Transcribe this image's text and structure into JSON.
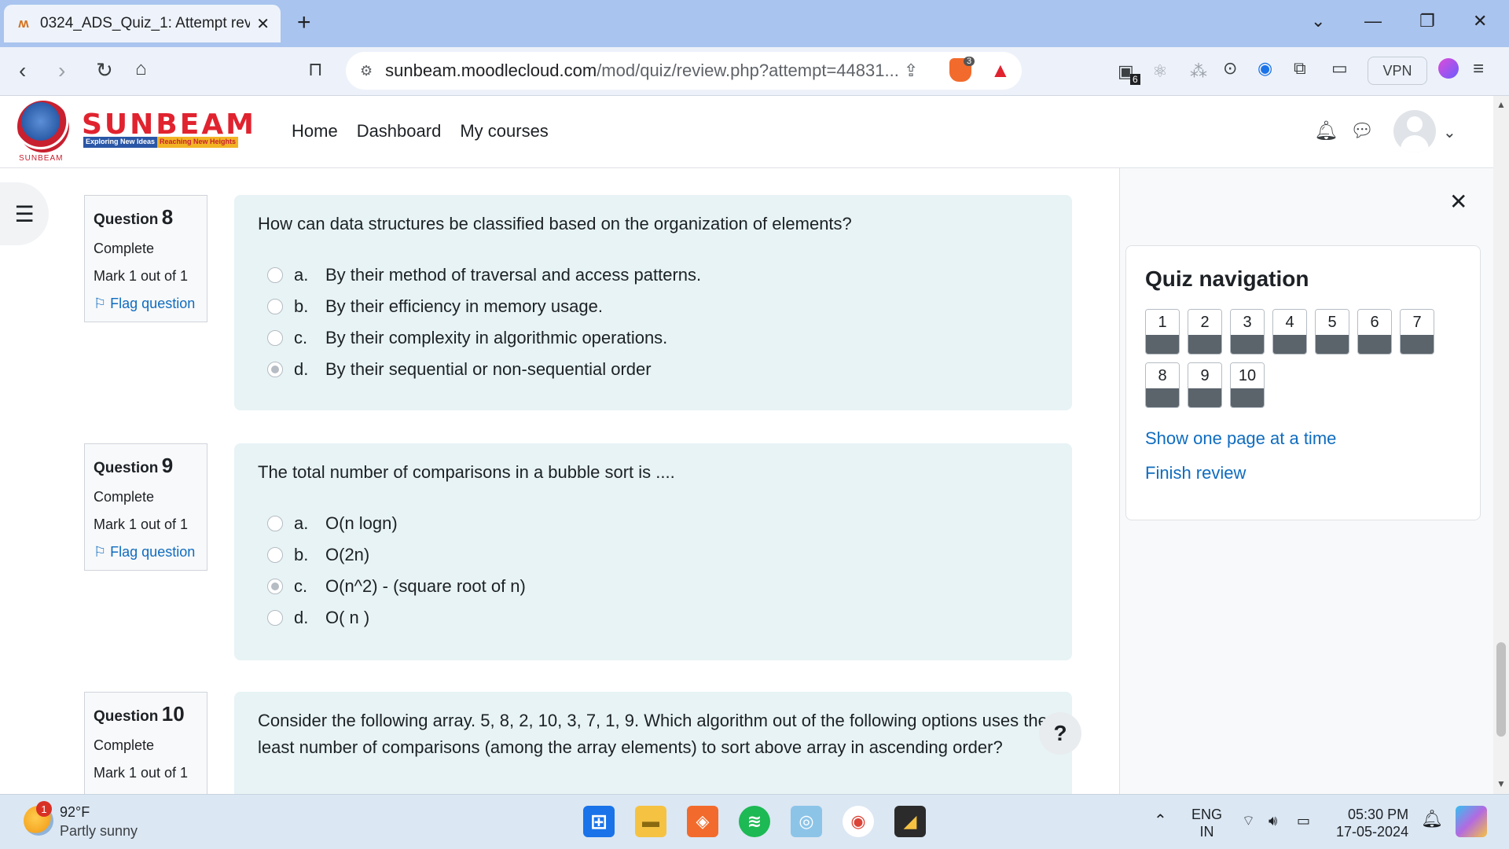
{
  "browser": {
    "tab_title": "0324_ADS_Quiz_1: Attempt revie",
    "tab_favicon": "ʍ",
    "url_host": "sunbeam.moodlecloud.com",
    "url_path": "/mod/quiz/review.php?attempt=44831...",
    "brave_badge": "3",
    "wallet_badge": "6",
    "vpn_label": "VPN"
  },
  "header": {
    "logo_text": "SUNBEAM",
    "logo_tag_1": "Exploring New Ideas",
    "logo_tag_2": "Reaching New Heights",
    "logo_small": "SUNBEAM",
    "nav": [
      "Home",
      "Dashboard",
      "My courses"
    ]
  },
  "questions": [
    {
      "label": "Question",
      "number": "8",
      "status": "Complete",
      "mark": "Mark 1 out of 1",
      "flag": "Flag question",
      "text": "How can data structures be classified based on the organization of elements?",
      "options": [
        {
          "letter": "a.",
          "text": "By their method of traversal and access patterns.",
          "selected": false
        },
        {
          "letter": "b.",
          "text": "By their efficiency in memory usage.",
          "selected": false
        },
        {
          "letter": "c.",
          "text": "By their complexity in algorithmic operations.",
          "selected": false
        },
        {
          "letter": "d.",
          "text": "By their sequential or non-sequential order",
          "selected": true
        }
      ]
    },
    {
      "label": "Question",
      "number": "9",
      "status": "Complete",
      "mark": "Mark 1 out of 1",
      "flag": "Flag question",
      "text": "The total number of comparisons in a bubble sort is ....",
      "options": [
        {
          "letter": "a.",
          "text": "O(n logn)",
          "selected": false
        },
        {
          "letter": "b.",
          "text": "O(2n)",
          "selected": false
        },
        {
          "letter": "c.",
          "text": "O(n^2) - (square root of n)",
          "selected": true
        },
        {
          "letter": "d.",
          "text": "O( n )",
          "selected": false
        }
      ]
    },
    {
      "label": "Question",
      "number": "10",
      "status": "Complete",
      "mark": "Mark 1 out of 1",
      "text": "Consider the following array. 5, 8, 2, 10, 3, 7, 1, 9. Which algorithm out of the following options uses the least number of comparisons (among the array elements) to sort above array in ascending order?"
    }
  ],
  "quiz_nav": {
    "title": "Quiz navigation",
    "buttons": [
      "1",
      "2",
      "3",
      "4",
      "5",
      "6",
      "7",
      "8",
      "9",
      "10"
    ],
    "show_one_page": "Show one page at a time",
    "finish_review": "Finish review"
  },
  "help_label": "?",
  "taskbar": {
    "weather_badge": "1",
    "temperature": "92°F",
    "weather": "Partly sunny",
    "lang_top": "ENG",
    "lang_bottom": "IN",
    "time": "05:30 PM",
    "date": "17-05-2024"
  }
}
